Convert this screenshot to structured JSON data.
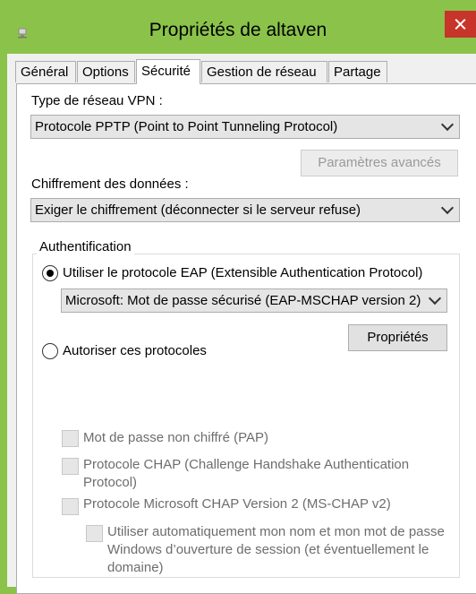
{
  "window": {
    "title": "Propriétés de altaven",
    "accent_color": "#8bc34a",
    "close_color": "#c7342a"
  },
  "tabs": [
    {
      "label": "Général",
      "active": false
    },
    {
      "label": "Options",
      "active": false
    },
    {
      "label": "Sécurité",
      "active": true
    },
    {
      "label": "Gestion de réseau",
      "active": false
    },
    {
      "label": "Partage",
      "active": false
    }
  ],
  "vpn": {
    "label": "Type de réseau VPN :",
    "selected": "Protocole PPTP (Point to Point Tunneling Protocol)",
    "advanced_button": "Paramètres avancés"
  },
  "encryption": {
    "label": "Chiffrement des données :",
    "selected": "Exiger le chiffrement (déconnecter si le serveur refuse)"
  },
  "auth": {
    "group_title": "Authentification",
    "eap_radio_label": "Utiliser le protocole EAP (Extensible Authentication Protocol)",
    "eap_selected": true,
    "eap_method": "Microsoft: Mot de passe sécurisé (EAP-MSCHAP version 2)",
    "properties_button": "Propriétés",
    "allow_radio_label": "Autoriser ces protocoles",
    "protocols": [
      {
        "label": "Mot de passe non chiffré (PAP)",
        "checked": false
      },
      {
        "label": "Protocole CHAP (Challenge Handshake Authentication Protocol)",
        "checked": false
      },
      {
        "label": "Protocole Microsoft CHAP Version 2 (MS-CHAP v2)",
        "checked": false
      }
    ],
    "auto_logon_label": "Utiliser automatiquement mon nom et mon mot de passe Windows d’ouverture de session (et éventuellement le domaine)"
  }
}
